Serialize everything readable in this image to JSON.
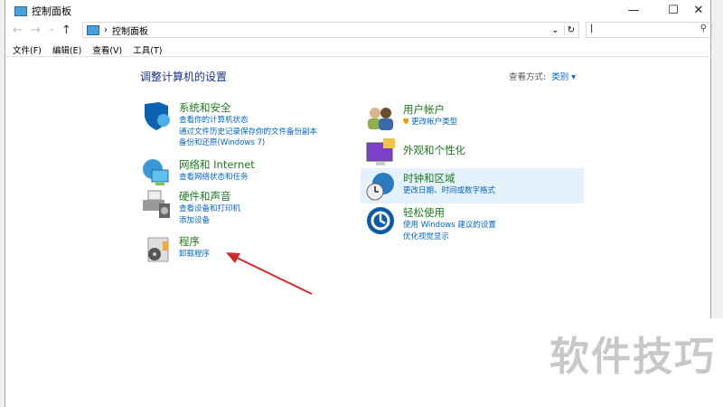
{
  "window": {
    "title": "控制面板",
    "minimize": "—",
    "maximize": "☐",
    "close": "✕"
  },
  "nav": {
    "back": "←",
    "forward": "→",
    "recent": "⌄",
    "up": "↑"
  },
  "address": {
    "sep": "›",
    "path": "控制面板",
    "dropdown": "⌄",
    "refresh": "↻"
  },
  "search": {
    "placeholder": "",
    "icon": "⚲"
  },
  "menu": [
    "文件(F)",
    "编辑(E)",
    "查看(V)",
    "工具(T)"
  ],
  "content": {
    "heading": "调整计算机的设置",
    "view_by_label": "查看方式:",
    "view_by_value": "类别",
    "view_by_caret": "▾"
  },
  "categories_left": [
    {
      "title": "系统和安全",
      "links": [
        "查看你的计算机状态",
        "通过文件历史记录保存你的文件备份副本",
        "备份和还原(Windows 7)"
      ]
    },
    {
      "title": "网络和 Internet",
      "links": [
        "查看网络状态和任务"
      ]
    },
    {
      "title": "硬件和声音",
      "links": [
        "查看设备和打印机",
        "添加设备"
      ]
    },
    {
      "title": "程序",
      "links": [
        "卸载程序"
      ]
    }
  ],
  "categories_right": [
    {
      "title": "用户帐户",
      "links": [
        "更改帐户类型"
      ]
    },
    {
      "title": "外观和个性化",
      "links": []
    },
    {
      "title": "时钟和区域",
      "links": [
        "更改日期、时间或数字格式"
      ]
    },
    {
      "title": "轻松使用",
      "links": [
        "使用 Windows 建议的设置",
        "优化视觉显示"
      ]
    }
  ],
  "watermark": "软件技巧",
  "colors": {
    "arrow": "#d42a2a",
    "link": "#0066cc",
    "category": "#1e7a1e",
    "highlight": "#e5f1fb"
  }
}
